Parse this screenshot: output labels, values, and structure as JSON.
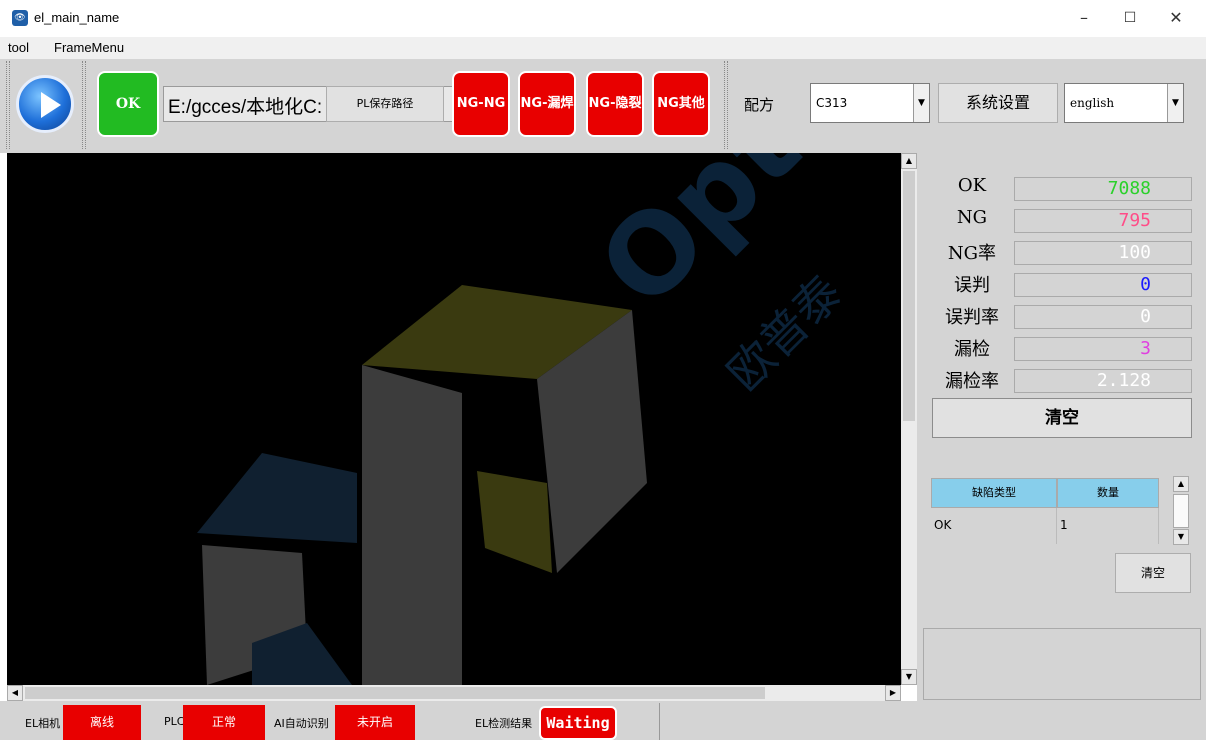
{
  "window": {
    "title": "el_main_name",
    "icon": "app-eye-icon",
    "controls": {
      "minimize": "–",
      "maximize": "☐",
      "close": "✕"
    }
  },
  "menu": {
    "items": [
      "tool",
      "FrameMenu"
    ]
  },
  "toolbar": {
    "ok_label": "OK",
    "path_value": "E:/gcces/本地化C:",
    "pl_label": "PL保存路径",
    "ng_buttons": [
      "NG-NG",
      "NG-漏焊",
      "NG-隐裂",
      "NG其他"
    ],
    "recipe_label": "配方",
    "recipe_value": "C313",
    "settings_label": "系统设置",
    "language_value": "english"
  },
  "stats": [
    {
      "label": "OK",
      "value": "7088",
      "color": "#2bd12b"
    },
    {
      "label": "NG",
      "value": "795",
      "color": "#ff4d88"
    },
    {
      "label": "NG率",
      "value": "100",
      "color": "#ffffff"
    },
    {
      "label": "误判",
      "value": "0",
      "color": "#1a1aff"
    },
    {
      "label": "误判率",
      "value": "0",
      "color": "#ffffff"
    },
    {
      "label": "漏检",
      "value": "3",
      "color": "#e040e0"
    },
    {
      "label": "漏检率",
      "value": "2.128",
      "color": "#ffffff"
    }
  ],
  "clear_label": "清空",
  "defect_table": {
    "headers": [
      "缺陷类型",
      "数量"
    ],
    "rows": [
      {
        "type": "OK",
        "count": "1"
      }
    ]
  },
  "clear2_label": "清空",
  "statusbar": {
    "camera_label": "EL相机",
    "camera_status": "离线",
    "plc_label": "PLC",
    "plc_status": "正常",
    "ai_label": "AI自动识别",
    "ai_status": "未开启",
    "result_label": "EL检测结果",
    "result_value": "Waiting"
  },
  "watermark": {
    "brand": "Opt",
    "brand_cn": "欧普泰"
  },
  "colors": {
    "ok_green": "#22bb22",
    "ng_red": "#e80000",
    "table_header": "#87ceeb"
  }
}
